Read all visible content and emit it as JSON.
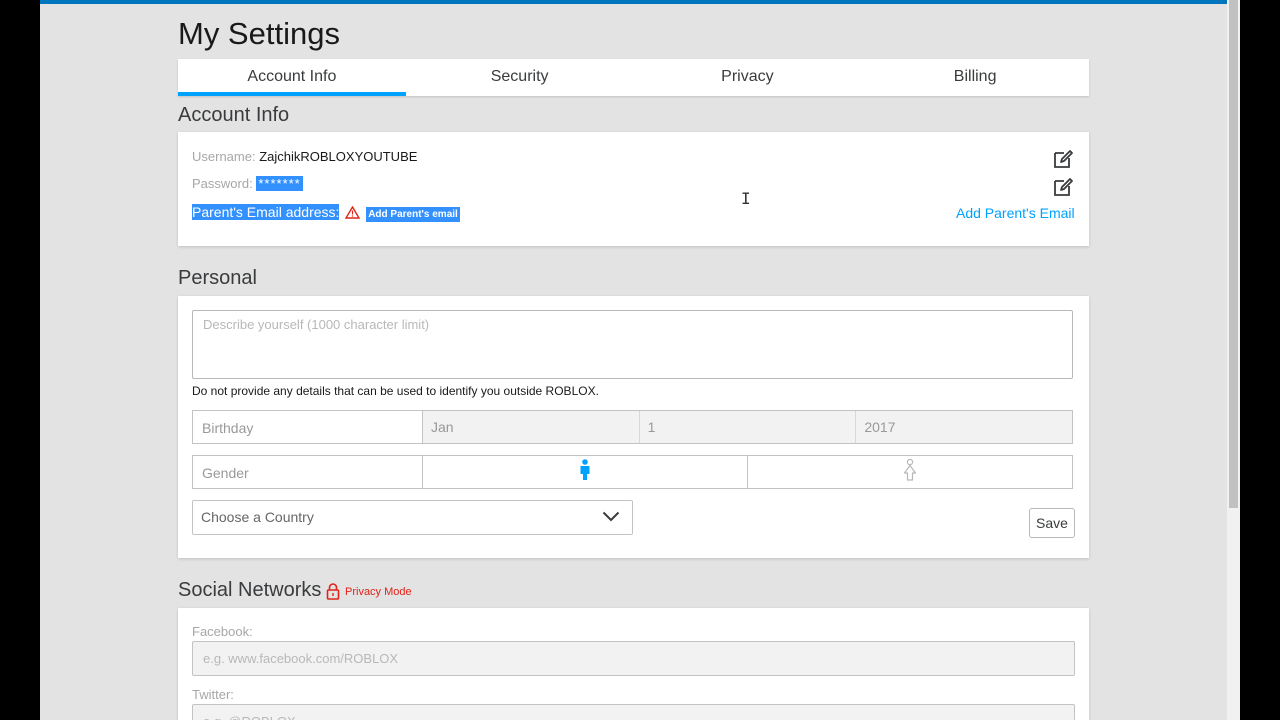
{
  "page": {
    "title": "My Settings"
  },
  "tabs": [
    {
      "label": "Account Info",
      "active": true
    },
    {
      "label": "Security",
      "active": false
    },
    {
      "label": "Privacy",
      "active": false
    },
    {
      "label": "Billing",
      "active": false
    }
  ],
  "account_info": {
    "section_title": "Account Info",
    "username_label": "Username:",
    "username_value": "ZajchikROBLOXYOUTUBE",
    "password_label": "Password:",
    "password_value": "*******",
    "parent_email_label": "Parent's Email address:",
    "parent_email_badge": "Add Parent's email",
    "add_parent_email_link": "Add Parent's Email"
  },
  "personal": {
    "section_title": "Personal",
    "description_placeholder": "Describe yourself (1000 character limit)",
    "hint": "Do not provide any details that can be used to identify you outside ROBLOX.",
    "birthday_label": "Birthday",
    "birthday_month": "Jan",
    "birthday_day": "1",
    "birthday_year": "2017",
    "gender_label": "Gender",
    "country_placeholder": "Choose a Country",
    "save_label": "Save"
  },
  "social": {
    "section_title": "Social Networks",
    "privacy_mode": "Privacy Mode",
    "facebook_label": "Facebook:",
    "facebook_placeholder": "e.g. www.facebook.com/ROBLOX",
    "twitter_label": "Twitter:",
    "twitter_placeholder": "e.g. @ROBLOX"
  },
  "colors": {
    "accent": "#00a2ff",
    "selection": "#3390ff",
    "warning": "#e2231a"
  }
}
